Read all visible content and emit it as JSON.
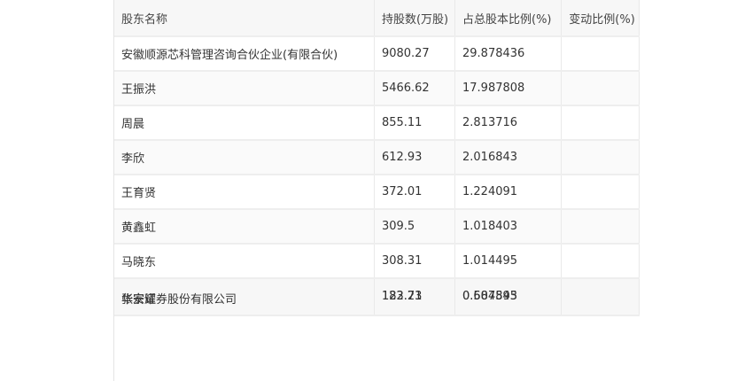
{
  "table": {
    "headers": [
      "股东名称",
      "持股数(万股)",
      "占总股本比例(%)",
      "变动比例(%)"
    ],
    "rows": [
      {
        "name": "安徽顺源芯科管理咨询合伙企业(有限合伙)",
        "shares": "9080.27",
        "ratio": "29.878436",
        "change": ""
      },
      {
        "name": "王振洪",
        "shares": "5466.62",
        "ratio": "17.987808",
        "change": ""
      },
      {
        "name": "周晨",
        "shares": "855.11",
        "ratio": "2.813716",
        "change": ""
      },
      {
        "name": "李欣",
        "shares": "612.93",
        "ratio": "2.016843",
        "change": ""
      },
      {
        "name": "王育贤",
        "shares": "372.01",
        "ratio": "1.224091",
        "change": ""
      },
      {
        "name": "黄鑫虹",
        "shares": "309.5",
        "ratio": "1.018403",
        "change": ""
      },
      {
        "name": "马晓东",
        "shares": "308.31",
        "ratio": "1.014495",
        "change": ""
      }
    ],
    "overlap_row": {
      "names": [
        "张宗耀",
        "华安证券股份有限公司"
      ],
      "shares": [
        "183.73",
        "122.21"
      ],
      "ratio": [
        "0.604545",
        "0.587893"
      ]
    }
  }
}
